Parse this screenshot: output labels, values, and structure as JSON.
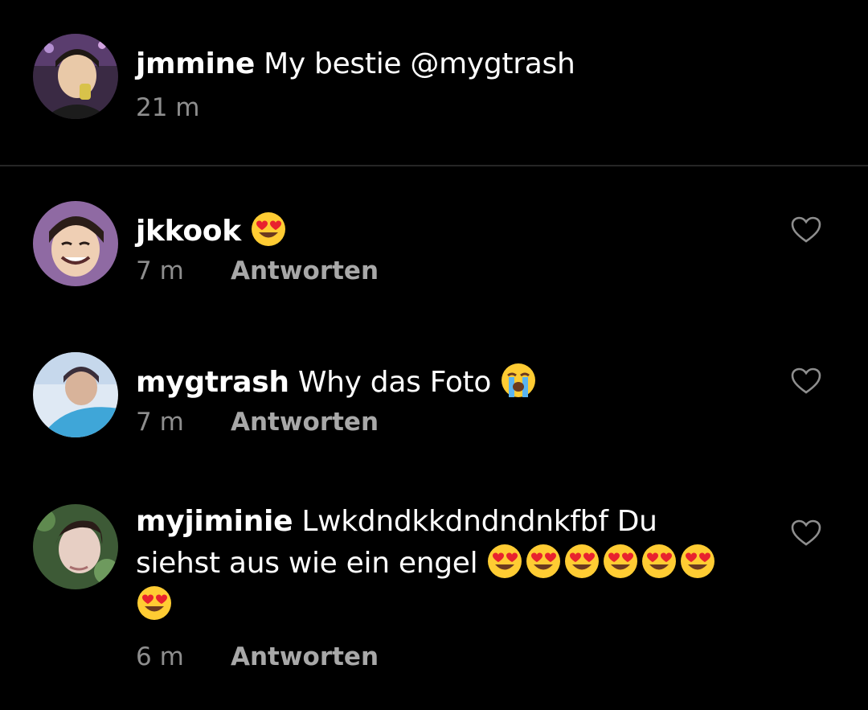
{
  "post": {
    "username": "jmmine",
    "text": "My bestie @mygtrash",
    "time": "21 m"
  },
  "comments": [
    {
      "username": "jkkook",
      "text": "",
      "emojis": [
        "heart-eyes"
      ],
      "time": "7 m",
      "reply_label": "Antworten"
    },
    {
      "username": "mygtrash",
      "text": "Why das Foto",
      "emojis": [
        "loudly-crying"
      ],
      "time": "7 m",
      "reply_label": "Antworten"
    },
    {
      "username": "myjiminie",
      "text": "Lwkdndkkdndndnkfbf Du siehst aus wie ein engel",
      "emojis": [
        "heart-eyes",
        "heart-eyes",
        "heart-eyes",
        "heart-eyes",
        "heart-eyes",
        "heart-eyes",
        "heart-eyes"
      ],
      "time": "6 m",
      "reply_label": "Antworten"
    }
  ],
  "colors": {
    "background": "#000000",
    "text": "#ffffff",
    "muted": "#8e8e8e",
    "divider": "#262626"
  }
}
